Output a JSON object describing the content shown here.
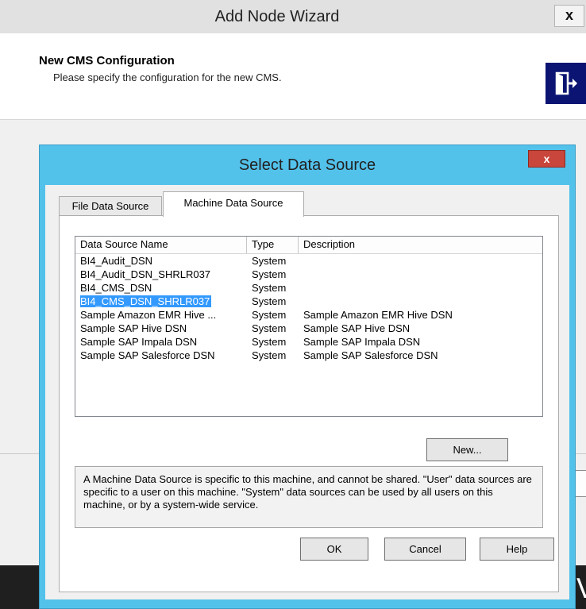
{
  "wizard": {
    "title": "Add Node Wizard",
    "close_label": "x",
    "heading": "New CMS Configuration",
    "subheading": "Please specify the configuration for the new CMS.",
    "logo_icon": "exit-door-icon"
  },
  "dialog": {
    "title": "Select Data Source",
    "close_label": "x",
    "tabs": [
      {
        "label": "File Data Source",
        "active": false
      },
      {
        "label": "Machine Data Source",
        "active": true
      }
    ],
    "columns": [
      "Data Source Name",
      "Type",
      "Description"
    ],
    "rows": [
      {
        "name": "BI4_Audit_DSN",
        "type": "System",
        "description": ""
      },
      {
        "name": "BI4_Audit_DSN_SHRLR037",
        "type": "System",
        "description": ""
      },
      {
        "name": "BI4_CMS_DSN",
        "type": "System",
        "description": ""
      },
      {
        "name": "BI4_CMS_DSN_SHRLR037",
        "type": "System",
        "description": "",
        "selected": true
      },
      {
        "name": "Sample Amazon EMR Hive ...",
        "type": "System",
        "description": "Sample Amazon EMR Hive DSN"
      },
      {
        "name": "Sample SAP Hive DSN",
        "type": "System",
        "description": "Sample SAP Hive DSN"
      },
      {
        "name": "Sample SAP Impala DSN",
        "type": "System",
        "description": "Sample SAP Impala DSN"
      },
      {
        "name": "Sample SAP Salesforce DSN",
        "type": "System",
        "description": "Sample SAP Salesforce DSN"
      }
    ],
    "new_button": "New...",
    "info_text": "A Machine Data Source is specific to this machine, and cannot be shared. \"User\" data sources are specific to a user on this machine.  \"System\" data sources can be used by all users on this machine, or by a system-wide service.",
    "buttons": {
      "ok": "OK",
      "cancel": "Cancel",
      "help": "Help"
    }
  },
  "taskbar": {
    "glyph": "Vi"
  },
  "colors": {
    "dialog_frame": "#53c2eb",
    "close_button": "#c8463b",
    "selection": "#3399ff",
    "wizard_logo": "#0b1472"
  }
}
